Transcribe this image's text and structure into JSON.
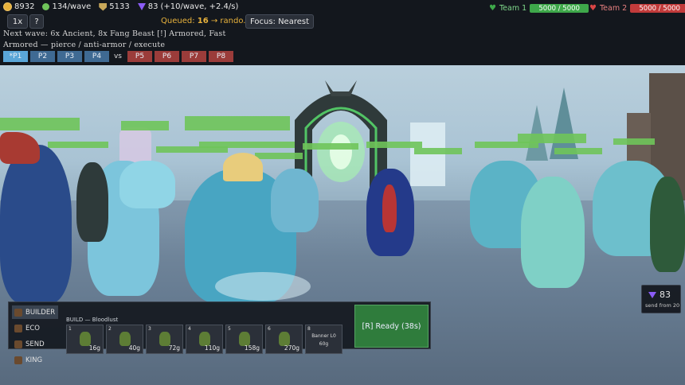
{
  "resources": {
    "gold": "8932",
    "income": "134/wave",
    "lumber": "5133",
    "gems": "83",
    "gem_rate": "(+10/wave, +2.4/s)"
  },
  "controls": {
    "speed": "1x",
    "help": "?",
    "queued_label": "Queued:",
    "queued_value": "16",
    "queued_rest": "→ rando...",
    "focus": "Focus: Nearest"
  },
  "info": {
    "next_wave": "Next wave: 6x Ancient, 8x Fang Beast   [!] Armored, Fast",
    "counters": "Armored — pierce / anti-armor / execute"
  },
  "players": {
    "left": [
      "*P1",
      "P2",
      "P3",
      "P4"
    ],
    "vs": "vs",
    "right": [
      "P5",
      "P6",
      "P7",
      "P8"
    ]
  },
  "teams": [
    {
      "label": "Team 1",
      "hp": "5000 / 5000",
      "color": "#3ea84a",
      "heart": "#3ea84a"
    },
    {
      "label": "Team 2",
      "hp": "5000 / 5000",
      "color": "#c23b3b",
      "heart": "#d94545"
    }
  ],
  "build_panel": {
    "tabs": [
      "BUILDER",
      "ECO",
      "SEND",
      "KING"
    ],
    "selected": "BUILDER",
    "title": "BUILD — Bloodlust",
    "cards": [
      {
        "num": "1",
        "cost": "16g"
      },
      {
        "num": "2",
        "cost": "40g"
      },
      {
        "num": "3",
        "cost": "72g"
      },
      {
        "num": "4",
        "cost": "110g"
      },
      {
        "num": "5",
        "cost": "158g"
      },
      {
        "num": "6",
        "cost": "270g"
      },
      {
        "num": "8",
        "name": "Banner L0",
        "cost": "60g"
      }
    ],
    "ready": "[R] Ready (38s)"
  },
  "gem_send": {
    "value": "83",
    "label": "send from 20"
  },
  "colors": {
    "accent_blue": "#5aa6d8",
    "team_green": "#3ea84a",
    "team_red": "#c23b3b",
    "gold": "#e8b23c",
    "gem": "#8b5cf6"
  }
}
